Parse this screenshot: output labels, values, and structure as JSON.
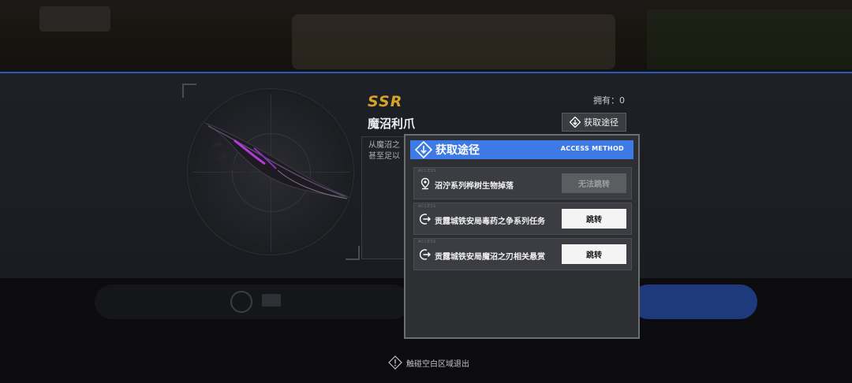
{
  "item": {
    "rarity": "SSR",
    "name": "魔沼利爪",
    "owned_label": "拥有：0",
    "description_lines": [
      "从魔沼之",
      "甚至足以"
    ]
  },
  "obtain_button": {
    "label": "获取途径",
    "icon": "diamond-arrow-icon"
  },
  "modal": {
    "title": "获取途径",
    "subtitle": "ACCESS METHOD",
    "header_color": "#3d7ae6",
    "routes": [
      {
        "tag": "ACCESS",
        "icon": "map-pin-icon",
        "text": "沼泞系列桦树生物掉落",
        "button": "无法跳转",
        "enabled": false
      },
      {
        "tag": "ACCESS",
        "icon": "exit-arrow-icon",
        "text": "贡露城铁安局毒药之争系列任务",
        "button": "跳转",
        "enabled": true
      },
      {
        "tag": "ACCESS",
        "icon": "exit-arrow-icon",
        "text": "贡露城铁安局魔沼之刃相关悬赏",
        "button": "跳转",
        "enabled": true
      }
    ]
  },
  "hint": {
    "text": "触碰空白区域退出",
    "icon": "diamond-info-icon"
  },
  "colors": {
    "rarity": "#d4a428",
    "accent_line": "#2b59b8"
  }
}
